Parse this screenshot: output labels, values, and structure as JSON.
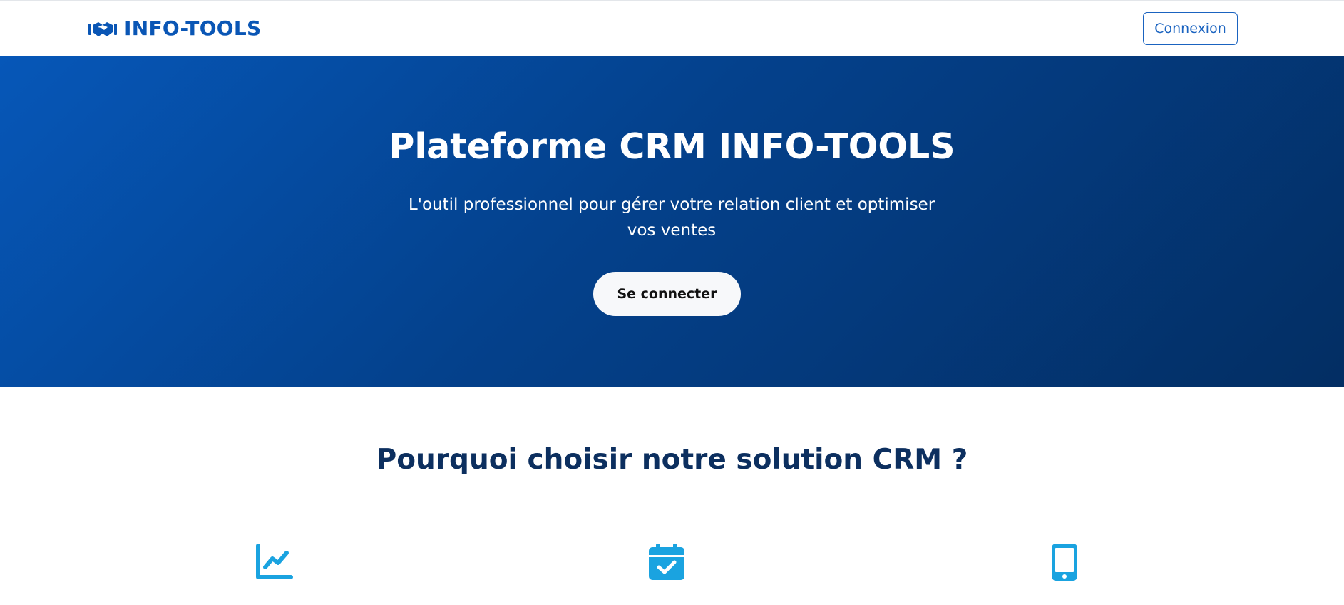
{
  "header": {
    "brand_text": "INFO-TOOLS",
    "brand_icon": "handshake-icon",
    "login_label": "Connexion"
  },
  "hero": {
    "title": "Plateforme CRM INFO-TOOLS",
    "subtitle": "L'outil professionnel pour gérer votre relation client et optimiser vos ventes",
    "cta_label": "Se connecter"
  },
  "features": {
    "title": "Pourquoi choisir notre solution CRM ?",
    "icons": [
      "chart-line-icon",
      "calendar-check-icon",
      "mobile-icon"
    ]
  },
  "colors": {
    "brand_blue": "#0a56b5",
    "hero_gradient_start": "#0657b8",
    "hero_gradient_end": "#032e63",
    "features_title": "#0c2f5f",
    "feature_icon": "#1aa3e0"
  }
}
